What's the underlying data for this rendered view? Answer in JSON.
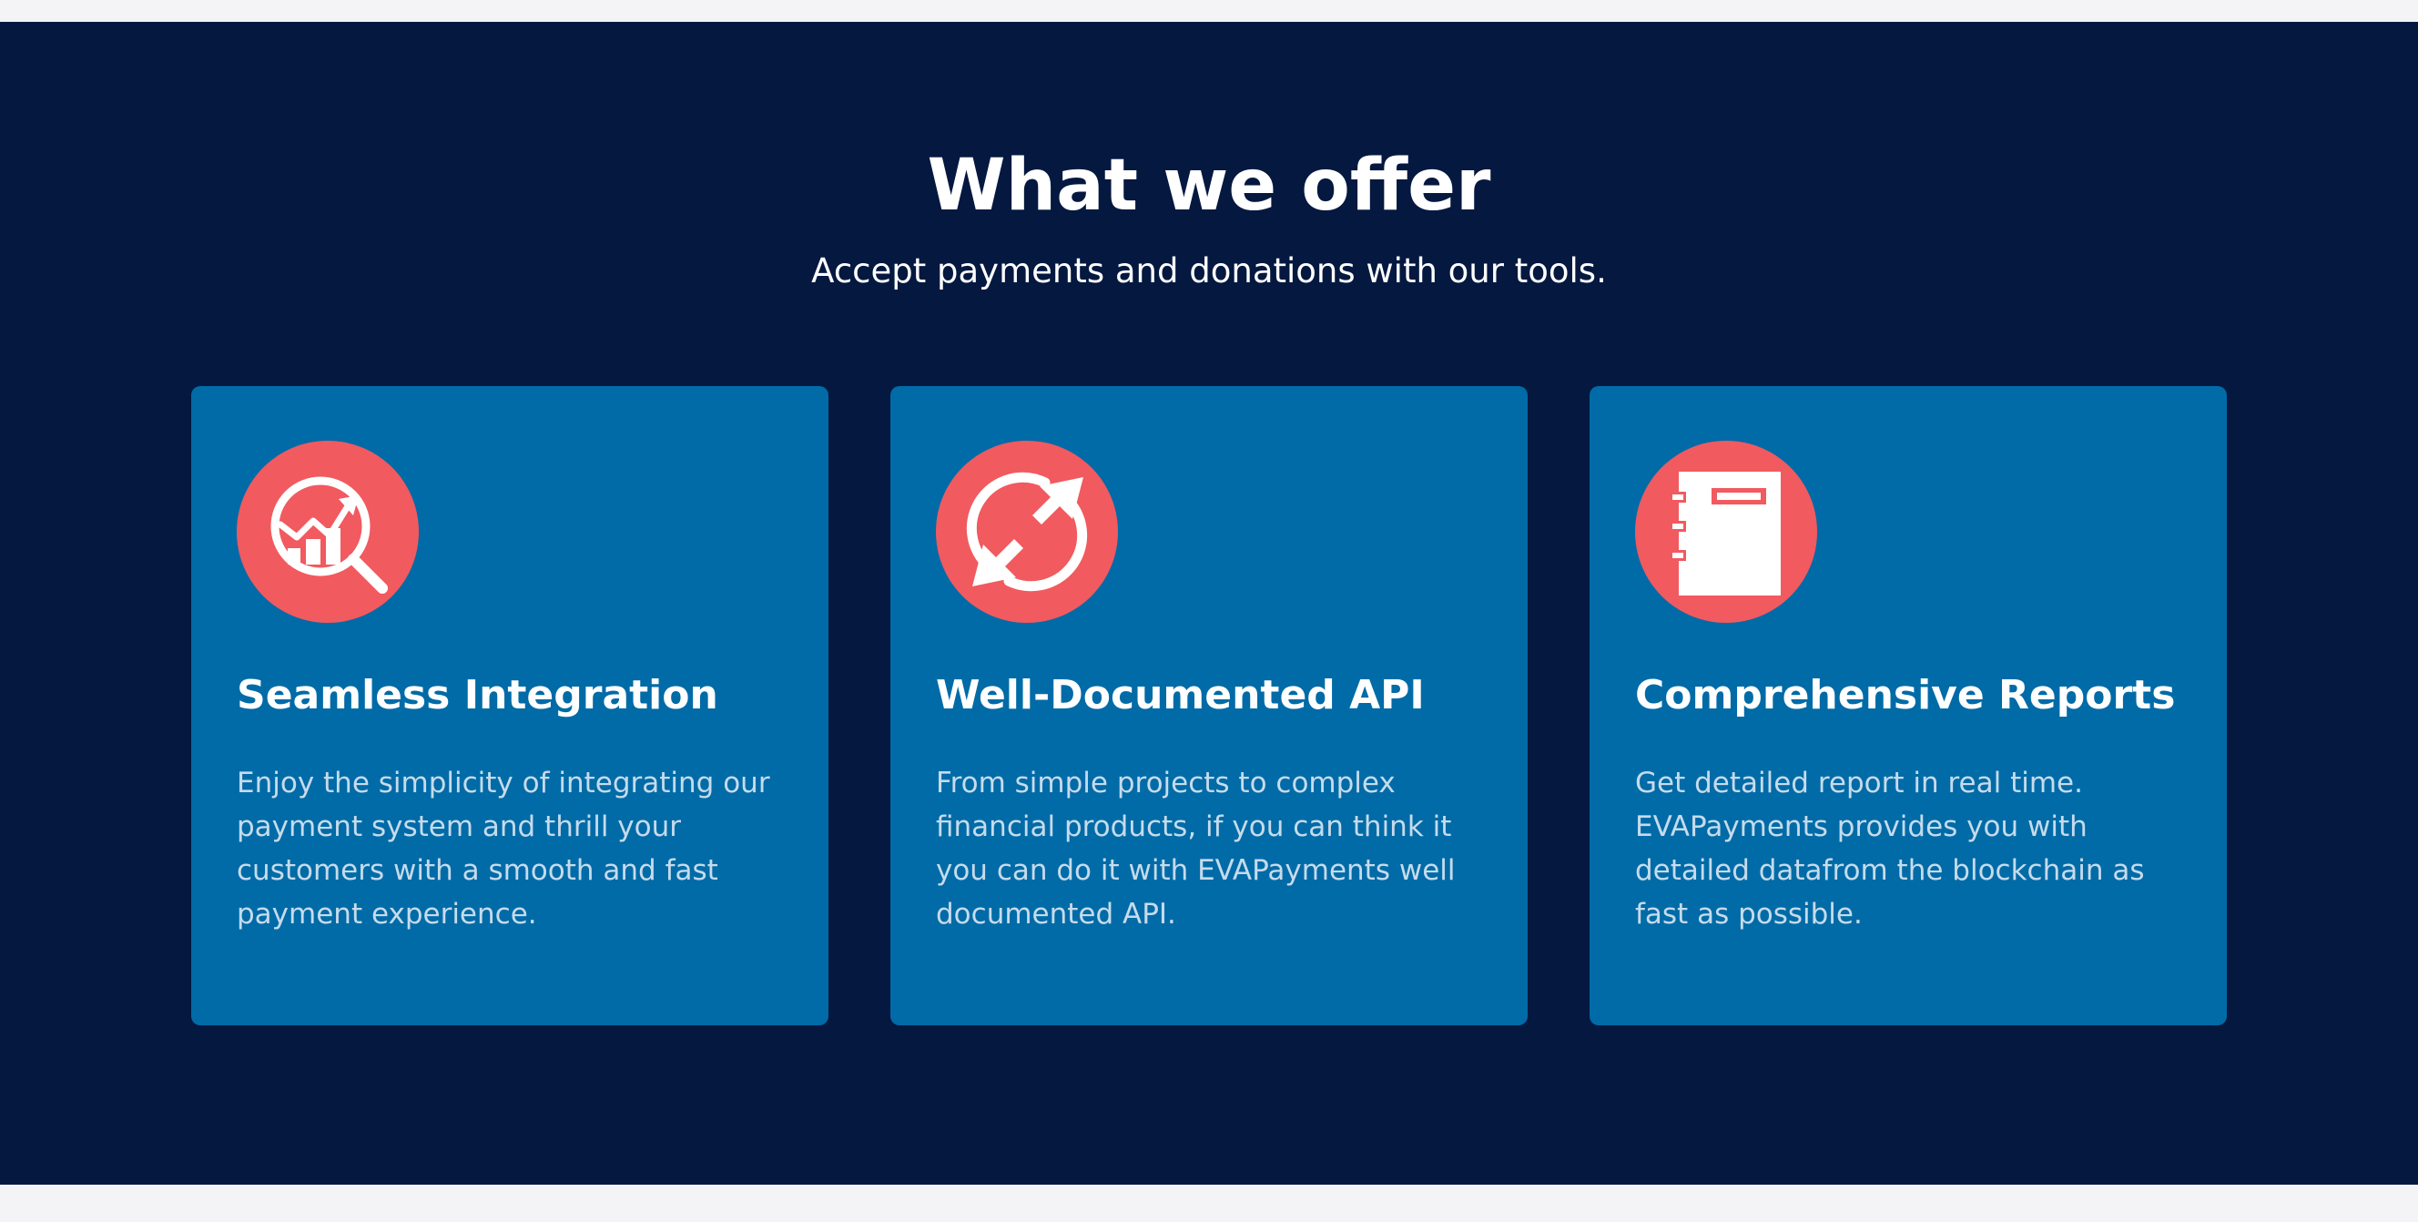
{
  "section": {
    "title": "What we offer",
    "subtitle": "Accept payments and donations with our tools."
  },
  "colors": {
    "background": "#041840",
    "card": "#006ba7",
    "icon_circle": "#f15a5f",
    "page_strip": "#f4f3f6"
  },
  "cards": [
    {
      "icon": "magnifier-chart-icon",
      "title": "Seamless Integration",
      "text": "Enjoy the simplicity of integrating our payment system and thrill your customers with a smooth and fast payment experience."
    },
    {
      "icon": "sync-arrows-icon",
      "title": "Well-Documented API",
      "text": "From simple projects to complex financial products, if you can think it you can do it with EVAPayments well documented API."
    },
    {
      "icon": "notebook-icon",
      "title": "Comprehensive Reports",
      "text": "Get detailed report in real time. EVAPayments provides you with detailed datafrom the blockchain as fast as possible."
    }
  ]
}
